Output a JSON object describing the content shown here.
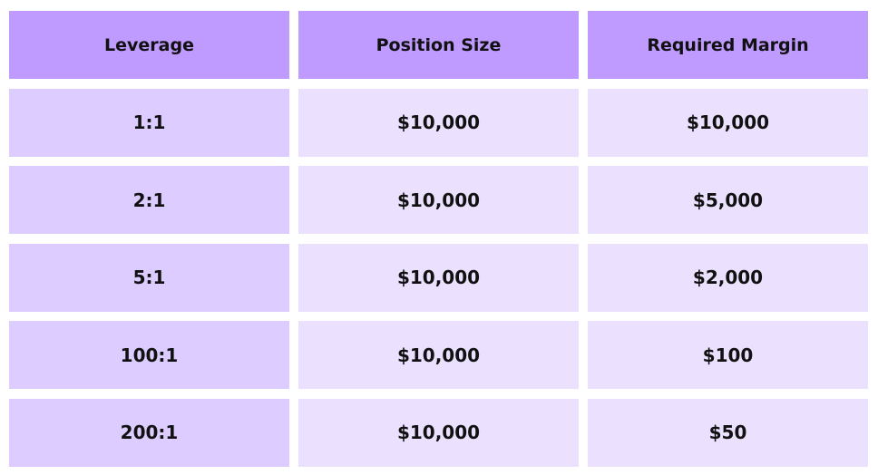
{
  "table": {
    "headers": [
      "Leverage",
      "Position Size",
      "Required Margin"
    ],
    "rows": [
      [
        "1:1",
        "$10,000",
        "$10,000"
      ],
      [
        "2:1",
        "$10,000",
        "$5,000"
      ],
      [
        "5:1",
        "$10,000",
        "$2,000"
      ],
      [
        "100:1",
        "$10,000",
        "$100"
      ],
      [
        "200:1",
        "$10,000",
        "$50"
      ]
    ]
  },
  "colors": {
    "header_bg": "#bf9aff",
    "first_col_bg": "#ddccff",
    "cell_bg": "#ebe1ff"
  }
}
